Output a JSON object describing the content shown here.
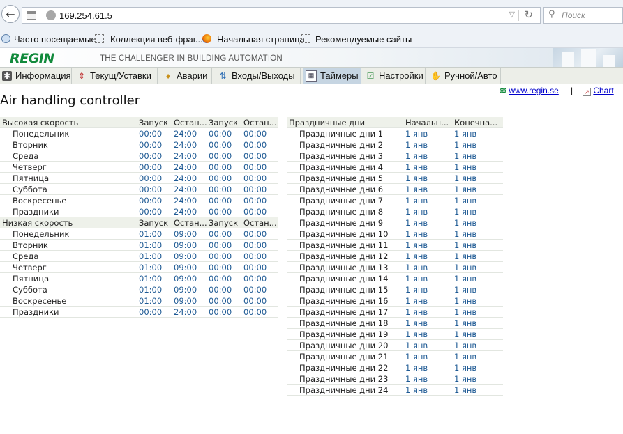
{
  "browser": {
    "url": "169.254.61.5",
    "search_placeholder": "Поиск",
    "bookmarks": [
      "Часто посещаемые",
      "Коллекция веб-фраг...",
      "Начальная страница",
      "Рекомендуемые сайты"
    ]
  },
  "header": {
    "logo": "REGIN",
    "tagline": "THE CHALLENGER IN BUILDING AUTOMATION"
  },
  "tabs": [
    {
      "label": "Информация",
      "icon": "gear-icon"
    },
    {
      "label": "Текущ/Уставки",
      "icon": "thermometer-icon"
    },
    {
      "label": "Аварии",
      "icon": "bell-icon"
    },
    {
      "label": "Входы/Выходы",
      "icon": "arrows-icon"
    },
    {
      "label": "Таймеры",
      "icon": "calendar-icon",
      "active": true
    },
    {
      "label": "Настройки",
      "icon": "checklist-icon"
    },
    {
      "label": "Ручной/Авто",
      "icon": "hand-icon"
    }
  ],
  "page": {
    "title": "Air handling controller",
    "site_link": "www.regin.se",
    "separator": "|",
    "chart_link": "Chart"
  },
  "schedule": {
    "high": {
      "title": "Высокая скорость",
      "columns": [
        "Запуск",
        "Остан...",
        "Запуск",
        "Остан..."
      ],
      "rows": [
        {
          "day": "Понедельник",
          "v": [
            "00:00",
            "24:00",
            "00:00",
            "00:00"
          ]
        },
        {
          "day": "Вторник",
          "v": [
            "00:00",
            "24:00",
            "00:00",
            "00:00"
          ]
        },
        {
          "day": "Среда",
          "v": [
            "00:00",
            "24:00",
            "00:00",
            "00:00"
          ]
        },
        {
          "day": "Четверг",
          "v": [
            "00:00",
            "24:00",
            "00:00",
            "00:00"
          ]
        },
        {
          "day": "Пятница",
          "v": [
            "00:00",
            "24:00",
            "00:00",
            "00:00"
          ]
        },
        {
          "day": "Суббота",
          "v": [
            "00:00",
            "24:00",
            "00:00",
            "00:00"
          ]
        },
        {
          "day": "Воскресенье",
          "v": [
            "00:00",
            "24:00",
            "00:00",
            "00:00"
          ]
        },
        {
          "day": "Праздники",
          "v": [
            "00:00",
            "24:00",
            "00:00",
            "00:00"
          ]
        }
      ]
    },
    "low": {
      "title": "Низкая скорость",
      "columns": [
        "Запуск",
        "Остан...",
        "Запуск",
        "Остан..."
      ],
      "rows": [
        {
          "day": "Понедельник",
          "v": [
            "01:00",
            "09:00",
            "00:00",
            "00:00"
          ]
        },
        {
          "day": "Вторник",
          "v": [
            "01:00",
            "09:00",
            "00:00",
            "00:00"
          ]
        },
        {
          "day": "Среда",
          "v": [
            "01:00",
            "09:00",
            "00:00",
            "00:00"
          ]
        },
        {
          "day": "Четверг",
          "v": [
            "01:00",
            "09:00",
            "00:00",
            "00:00"
          ]
        },
        {
          "day": "Пятница",
          "v": [
            "01:00",
            "09:00",
            "00:00",
            "00:00"
          ]
        },
        {
          "day": "Суббота",
          "v": [
            "01:00",
            "09:00",
            "00:00",
            "00:00"
          ]
        },
        {
          "day": "Воскресенье",
          "v": [
            "01:00",
            "09:00",
            "00:00",
            "00:00"
          ]
        },
        {
          "day": "Праздники",
          "v": [
            "00:00",
            "24:00",
            "00:00",
            "00:00"
          ]
        }
      ]
    }
  },
  "holidays": {
    "title": "Праздничные дни",
    "columns": [
      "Начальн...",
      "Конечна..."
    ],
    "rows": [
      {
        "name": "Праздничные дни 1",
        "start": "1 янв",
        "end": "1 янв"
      },
      {
        "name": "Праздничные дни 2",
        "start": "1 янв",
        "end": "1 янв"
      },
      {
        "name": "Праздничные дни 3",
        "start": "1 янв",
        "end": "1 янв"
      },
      {
        "name": "Праздничные дни 4",
        "start": "1 янв",
        "end": "1 янв"
      },
      {
        "name": "Праздничные дни 5",
        "start": "1 янв",
        "end": "1 янв"
      },
      {
        "name": "Праздничные дни 6",
        "start": "1 янв",
        "end": "1 янв"
      },
      {
        "name": "Праздничные дни 7",
        "start": "1 янв",
        "end": "1 янв"
      },
      {
        "name": "Праздничные дни 8",
        "start": "1 янв",
        "end": "1 янв"
      },
      {
        "name": "Праздничные дни 9",
        "start": "1 янв",
        "end": "1 янв"
      },
      {
        "name": "Праздничные дни 10",
        "start": "1 янв",
        "end": "1 янв"
      },
      {
        "name": "Праздничные дни 11",
        "start": "1 янв",
        "end": "1 янв"
      },
      {
        "name": "Праздничные дни 12",
        "start": "1 янв",
        "end": "1 янв"
      },
      {
        "name": "Праздничные дни 13",
        "start": "1 янв",
        "end": "1 янв"
      },
      {
        "name": "Праздничные дни 14",
        "start": "1 янв",
        "end": "1 янв"
      },
      {
        "name": "Праздничные дни 15",
        "start": "1 янв",
        "end": "1 янв"
      },
      {
        "name": "Праздничные дни 16",
        "start": "1 янв",
        "end": "1 янв"
      },
      {
        "name": "Праздничные дни 17",
        "start": "1 янв",
        "end": "1 янв"
      },
      {
        "name": "Праздничные дни 18",
        "start": "1 янв",
        "end": "1 янв"
      },
      {
        "name": "Праздничные дни 19",
        "start": "1 янв",
        "end": "1 янв"
      },
      {
        "name": "Праздничные дни 20",
        "start": "1 янв",
        "end": "1 янв"
      },
      {
        "name": "Праздничные дни 21",
        "start": "1 янв",
        "end": "1 янв"
      },
      {
        "name": "Праздничные дни 22",
        "start": "1 янв",
        "end": "1 янв"
      },
      {
        "name": "Праздничные дни 23",
        "start": "1 янв",
        "end": "1 янв"
      },
      {
        "name": "Праздничные дни 24",
        "start": "1 янв",
        "end": "1 янв"
      }
    ]
  },
  "colors": {
    "logo": "#128a3c",
    "value_text": "#1e5a94",
    "header_row_bg": "#eef1ea",
    "active_tab_bg": "#c6d5e2",
    "link": "#0000cc"
  }
}
